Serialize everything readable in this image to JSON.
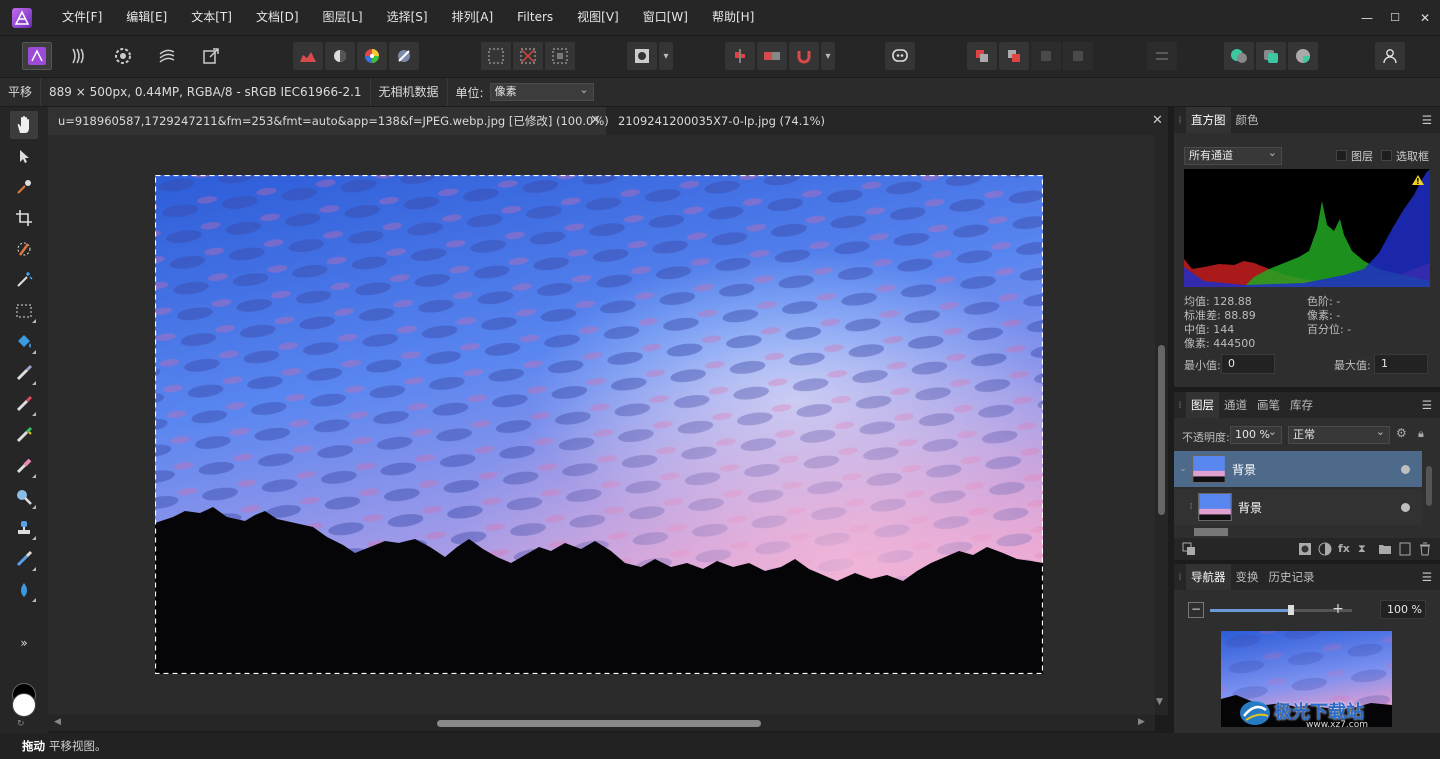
{
  "menu": {
    "items": [
      "文件[F]",
      "编辑[E]",
      "文本[T]",
      "文档[D]",
      "图层[L]",
      "选择[S]",
      "排列[A]",
      "Filters",
      "视图[V]",
      "窗口[W]",
      "帮助[H]"
    ]
  },
  "window_controls": {
    "minimize": "—",
    "maximize": "☐",
    "close": "✕"
  },
  "context_bar": {
    "tool_name": "平移",
    "image_info": "889 × 500px, 0.44MP, RGBA/8 - sRGB IEC61966-2.1",
    "metadata": "无相机数据",
    "unit_label": "单位:",
    "unit_value": "像素"
  },
  "documents": {
    "tabs": [
      {
        "title": "u=918960587,1729247211&fm=253&fmt=auto&app=138&f=JPEG.webp.jpg [已修改] (100.0%)"
      },
      {
        "title": "2109241200035X7-0-lp.jpg (74.1%)"
      }
    ],
    "close": "✕"
  },
  "status": {
    "action": "拖动",
    "description": "平移视图。"
  },
  "histogram_panel": {
    "tabs": [
      "直方图",
      "颜色"
    ],
    "channel": "所有通道",
    "layers_check": "图层",
    "selection_check": "选取框",
    "stats_left": [
      "均值: 128.88",
      "标准差: 88.89",
      "中值: 144",
      "像素: 444500"
    ],
    "stats_right": [
      "色阶: -",
      "像素: -",
      "百分位: -"
    ],
    "min_label": "最小值:",
    "min_value": "0",
    "max_label": "最大值:",
    "max_value": "1",
    "warning": "!"
  },
  "layers_panel": {
    "tabs": [
      "图层",
      "通道",
      "画笔",
      "库存"
    ],
    "opacity_label": "不透明度:",
    "opacity_value": "100 %",
    "blend_mode": "正常",
    "layers": [
      {
        "name": "背景"
      },
      {
        "name": "背景"
      }
    ]
  },
  "navigator_panel": {
    "tabs": [
      "导航器",
      "变换",
      "历史记录"
    ],
    "zoom_value": "100 %",
    "zoom_level": 0.57
  },
  "watermark": {
    "text": "极光下载站",
    "url": "www.xz7.com"
  },
  "colors": {
    "accent": "#4a6a8a",
    "layer_selected": "#4d6a8a",
    "app_purple": "#8a3cc8"
  }
}
